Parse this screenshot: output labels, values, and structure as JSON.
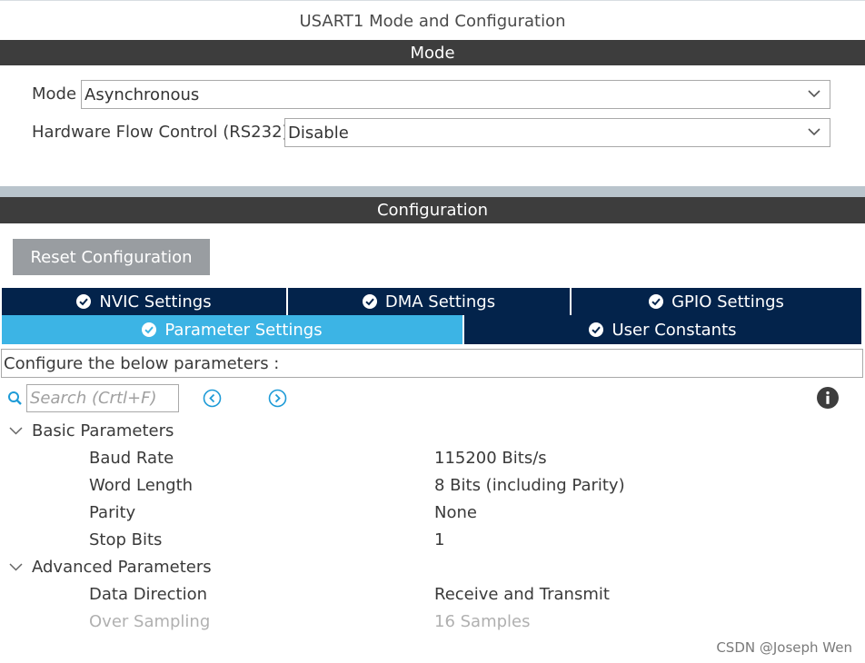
{
  "window": {
    "title": "USART1 Mode and Configuration"
  },
  "mode_section": {
    "header": "Mode",
    "mode": {
      "label": "Mode",
      "value": "Asynchronous"
    },
    "flow_control": {
      "label": "Hardware Flow Control (RS232)",
      "value": "Disable"
    }
  },
  "config_section": {
    "header": "Configuration",
    "reset_button": "Reset Configuration",
    "tabs_row1": [
      {
        "label": "NVIC Settings",
        "icon": "check-circle-icon"
      },
      {
        "label": "DMA Settings",
        "icon": "check-circle-icon"
      },
      {
        "label": "GPIO Settings",
        "icon": "check-circle-icon"
      }
    ],
    "tabs_row2": [
      {
        "label": "Parameter Settings",
        "icon": "check-circle-icon",
        "active": true
      },
      {
        "label": "User Constants",
        "icon": "check-circle-icon"
      }
    ],
    "description": "Configure the below parameters :",
    "search": {
      "placeholder": "Search (Crtl+F)"
    },
    "groups": [
      {
        "name": "Basic Parameters",
        "params": [
          {
            "name": "Baud Rate",
            "value": "115200 Bits/s"
          },
          {
            "name": "Word Length",
            "value": "8 Bits (including Parity)"
          },
          {
            "name": "Parity",
            "value": "None"
          },
          {
            "name": "Stop Bits",
            "value": "1"
          }
        ]
      },
      {
        "name": "Advanced Parameters",
        "params": [
          {
            "name": "Data Direction",
            "value": "Receive and Transmit"
          },
          {
            "name": "Over Sampling",
            "value": "16 Samples",
            "disabled": true
          }
        ]
      }
    ]
  },
  "colors": {
    "header_bar": "#3d3d3d",
    "tab_dark": "#03234b",
    "tab_active": "#3cb4e5",
    "accent_blue": "#1e9bd7"
  },
  "watermark": "CSDN @Joseph Wen"
}
